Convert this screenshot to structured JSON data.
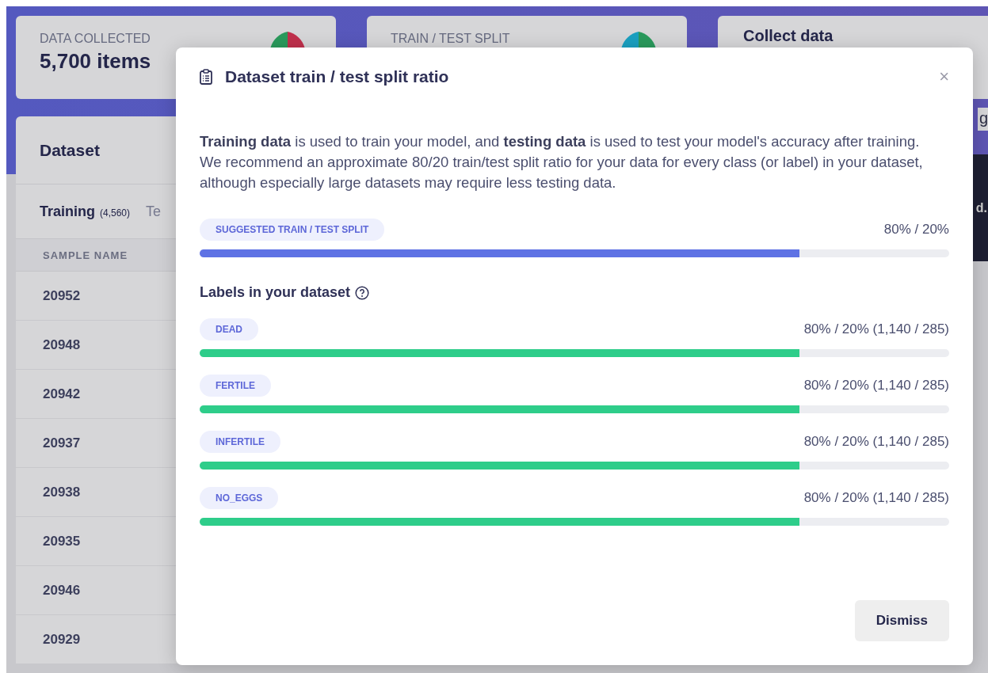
{
  "background": {
    "stat_cards": [
      {
        "label": "DATA COLLECTED",
        "value": "5,700 items"
      },
      {
        "label": "TRAIN / TEST SPLIT"
      }
    ],
    "collect_card": {
      "title": "Collect data"
    },
    "dataset_panel": {
      "title": "Dataset",
      "tabs": [
        {
          "label": "Training",
          "count": "(4,560)",
          "selected": true
        },
        {
          "label": "Te",
          "selected": false
        }
      ],
      "columns": [
        "SAMPLE NAME"
      ],
      "rows": [
        "20952",
        "20948",
        "20942",
        "20937",
        "20938",
        "20935",
        "20946",
        "20929"
      ]
    },
    "edge_fragments": [
      "g",
      "d."
    ]
  },
  "modal": {
    "title": "Dataset train / test split ratio",
    "close": "×",
    "intro": "**Training data** is used to train your model, and **testing data** is used to test your model's accuracy after training. We recommend an approximate 80/20 train/test split ratio for your data for every class (or label) in your dataset, although especially large datasets may require less testing data.",
    "suggested": {
      "label": "SUGGESTED TRAIN / TEST SPLIT",
      "reading": "80% / 20%",
      "level": 0.8
    },
    "labels_heading": "Labels in your dataset",
    "labels": [
      {
        "name": "DEAD",
        "reading": "80% / 20% (1,140 / 285)",
        "level": 0.8
      },
      {
        "name": "FERTILE",
        "reading": "80% / 20% (1,140 / 285)",
        "level": 0.8
      },
      {
        "name": "INFERTILE",
        "reading": "80% / 20% (1,140 / 285)",
        "level": 0.8
      },
      {
        "name": "NO_EGGS",
        "reading": "80% / 20% (1,140 / 285)",
        "level": 0.8
      }
    ],
    "dismiss": "Dismiss"
  }
}
